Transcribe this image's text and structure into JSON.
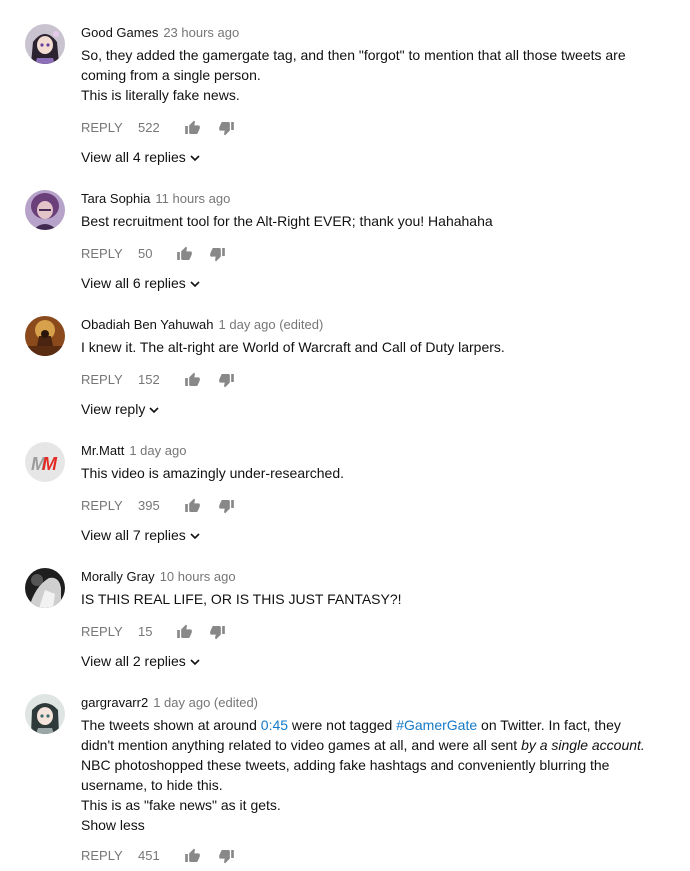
{
  "comments": [
    {
      "author": "Good Games",
      "time": "23 hours ago",
      "lines": [
        "So, they added the gamergate tag, and then \"forgot\" to mention that all those tweets are",
        "coming from a single person.",
        "This is literally fake news."
      ],
      "reply_label": "REPLY",
      "likes": "522",
      "replies_label": "View all 4 replies",
      "avatar_icon": "anime-girl-avatar"
    },
    {
      "author": "Tara Sophia",
      "time": "11 hours ago",
      "lines": [
        "Best recruitment tool for the Alt-Right EVER; thank you! Hahahaha"
      ],
      "reply_label": "REPLY",
      "likes": "50",
      "replies_label": "View all 6 replies",
      "avatar_icon": "portrait-avatar"
    },
    {
      "author": "Obadiah Ben Yahuwah",
      "time": "1 day ago (edited)",
      "lines": [
        "I knew it. The alt-right are World of Warcraft and Call of Duty larpers."
      ],
      "reply_label": "REPLY",
      "likes": "152",
      "replies_label": "View reply",
      "avatar_icon": "painting-avatar"
    },
    {
      "author": "Mr.Matt",
      "time": "1 day ago",
      "lines": [
        "This video is amazingly under-researched."
      ],
      "reply_label": "REPLY",
      "likes": "395",
      "replies_label": "View all 7 replies",
      "avatar_icon": "mm-logo-avatar",
      "avatar_text": "MM"
    },
    {
      "author": "Morally Gray",
      "time": "10 hours ago",
      "lines": [
        "IS THIS REAL LIFE, OR IS THIS JUST FANTASY?!"
      ],
      "reply_label": "REPLY",
      "likes": "15",
      "replies_label": "View all 2 replies",
      "avatar_icon": "bw-photo-avatar"
    },
    {
      "author": "gargravarr2",
      "time": "1 day ago (edited)",
      "text": {
        "p1": "The tweets shown at around ",
        "ts": "0:45",
        "p2": " were not tagged ",
        "tag": "#GamerGate",
        "p3": " on Twitter. In fact, they didn't mention anything related to video games at all, and were all sent ",
        "em": "by a single account.",
        "p4": " NBC photoshopped these tweets, adding fake hashtags and conveniently blurring the username, to hide this.",
        "last": "This is as \"fake news\" as it gets."
      },
      "show_less": "Show less",
      "reply_label": "REPLY",
      "likes": "451",
      "avatar_icon": "anime-boy-avatar"
    }
  ],
  "colors": {
    "text": "#111111",
    "meta": "#767676",
    "link": "#167ac6",
    "mm_red": "#e22b24"
  }
}
